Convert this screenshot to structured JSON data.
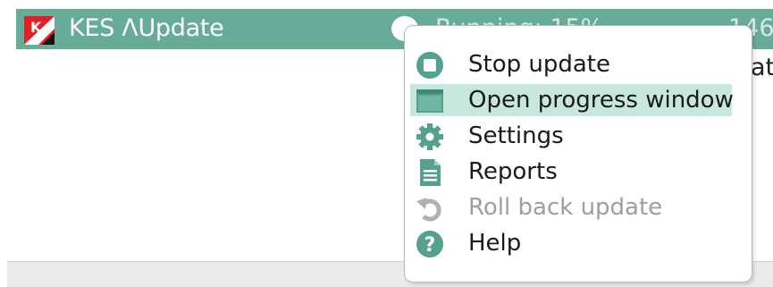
{
  "task": {
    "name": "KES ΛUpdate",
    "status": "Running: 15%",
    "extra": "146..."
  },
  "background_snippet": "at",
  "context_menu": {
    "items": [
      {
        "label": "Stop update",
        "icon": "stop-icon",
        "enabled": true
      },
      {
        "label": "Open progress window",
        "icon": "window-icon",
        "enabled": true,
        "highlighted": true
      },
      {
        "label": "Settings",
        "icon": "gear-icon",
        "enabled": true
      },
      {
        "label": "Reports",
        "icon": "document-icon",
        "enabled": true
      },
      {
        "label": "Roll back update",
        "icon": "undo-icon",
        "enabled": false
      },
      {
        "label": "Help",
        "icon": "help-icon",
        "enabled": true
      }
    ]
  },
  "colors": {
    "row_accent": "#67ab99",
    "icon_accent": "#54a190",
    "highlight": "#c7e6dd",
    "disabled_text": "#9e9e9e"
  }
}
